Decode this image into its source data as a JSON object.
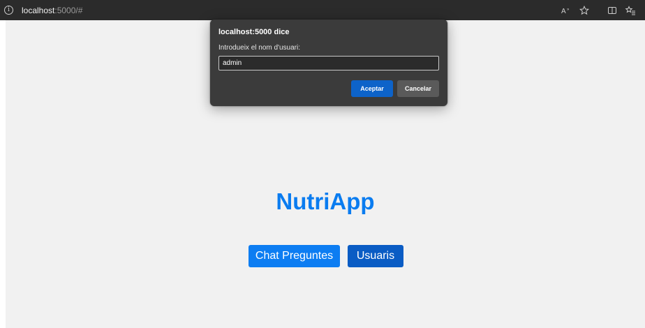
{
  "browser": {
    "url_host": "localhost",
    "url_path": ":5000/#",
    "icons": [
      "info-icon",
      "read-aloud-icon",
      "favorite-star-icon",
      "split-screen-icon",
      "favorites-list-icon"
    ]
  },
  "page": {
    "title": "NutriApp",
    "buttons": {
      "chat": "Chat Preguntes",
      "users": "Usuaris"
    }
  },
  "dialog": {
    "title": "localhost:5000 dice",
    "message": "Introdueix el nom d'usuari:",
    "input_value": "admin",
    "ok_label": "Aceptar",
    "cancel_label": "Cancelar"
  },
  "colors": {
    "title_blue": "#0a7cf0",
    "chat_button": "#0d7df2",
    "users_button": "#0a5cc4",
    "dialog_bg": "#3b3b3b",
    "dialog_ok": "#0d63c9"
  }
}
